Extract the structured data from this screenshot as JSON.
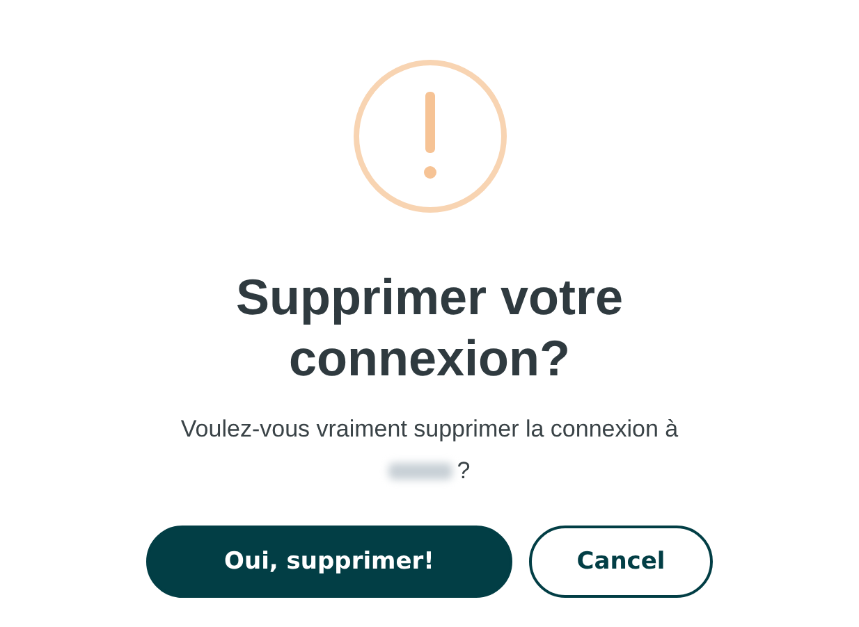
{
  "dialog": {
    "title": "Supprimer votre connexion?",
    "message": "Voulez-vous vraiment supprimer la connexion à",
    "message_end": "?",
    "buttons": [
      {
        "kind": "primary",
        "label": "Oui, supprimer!"
      },
      {
        "kind": "secondary",
        "label": "Cancel"
      }
    ]
  }
}
